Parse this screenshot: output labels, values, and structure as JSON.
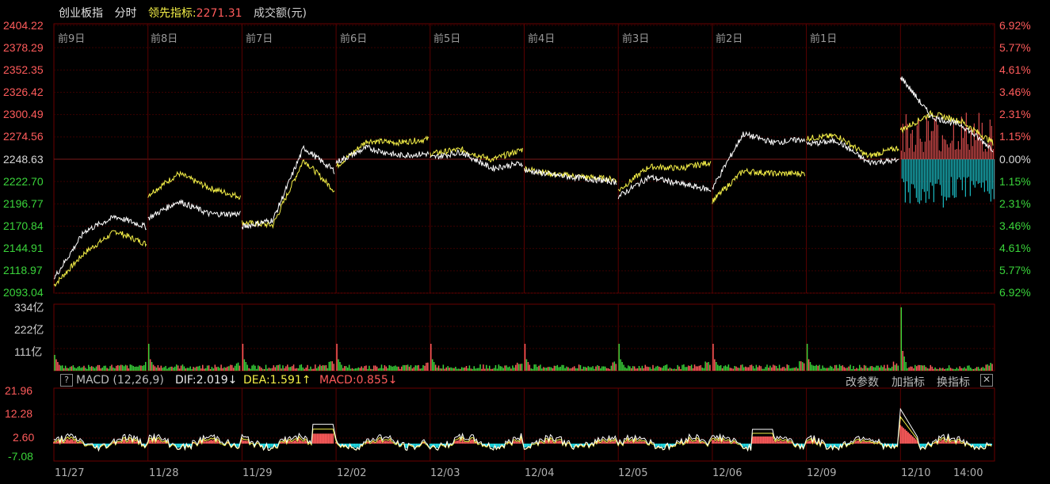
{
  "header": {
    "name": "创业板指",
    "mode": "分时",
    "lead_label": "领先指标:",
    "lead_value": "2271.31",
    "turnover_label": "成交额(元)"
  },
  "price_axis_left": [
    "2404.22",
    "2378.29",
    "2352.35",
    "2326.42",
    "2300.49",
    "2274.56",
    "2248.63",
    "2222.70",
    "2196.77",
    "2170.84",
    "2144.91",
    "2118.97",
    "2093.04"
  ],
  "pct_axis_right": [
    "6.92%",
    "5.77%",
    "4.61%",
    "3.46%",
    "2.31%",
    "1.15%",
    "0.00%",
    "1.15%",
    "2.31%",
    "3.46%",
    "4.61%",
    "5.77%",
    "6.92%"
  ],
  "day_labels": [
    "前9日",
    "前8日",
    "前7日",
    "前6日",
    "前5日",
    "前4日",
    "前3日",
    "前2日",
    "前1日"
  ],
  "volume_axis": [
    "334亿",
    "222亿",
    "111亿"
  ],
  "macd": {
    "question": "?",
    "title": "MACD (12,26,9)",
    "dif": "DIF:2.019↓",
    "dea": "DEA:1.591↑",
    "macd": "MACD:0.855↓",
    "axis": [
      "21.96",
      "12.28",
      "2.60",
      "-7.08"
    ]
  },
  "toolbar": {
    "change_params": "改参数",
    "add_indicator": "加指标",
    "switch_indicator": "换指标",
    "close": "✕"
  },
  "date_axis": [
    "11/27",
    "11/28",
    "11/29",
    "12/02",
    "12/03",
    "12/04",
    "12/05",
    "12/06",
    "12/09",
    "12/10",
    "14:00"
  ],
  "colors": {
    "up": "#ff5b5b",
    "down": "#3ad43a",
    "white_line": "#ffffff",
    "yellow_line": "#f5f047",
    "cyan": "#21e0e8",
    "grid": "#3a0000"
  },
  "chart_data": {
    "type": "line",
    "title": "创业板指",
    "xlabel": "",
    "ylabel": "",
    "ylim": [
      2093.04,
      2404.22
    ],
    "prev_close": 2248.63,
    "x": [
      "11/27",
      "11/28",
      "11/29",
      "12/02",
      "12/03",
      "12/04",
      "12/05",
      "12/06",
      "12/09",
      "12/10"
    ],
    "series": [
      {
        "name": "创业板指",
        "values": [
          [
            2110,
            2165,
            2182,
            2170
          ],
          [
            2180,
            2200,
            2185,
            2185
          ],
          [
            2170,
            2178,
            2262,
            2235
          ],
          [
            2245,
            2262,
            2253,
            2255
          ],
          [
            2250,
            2257,
            2238,
            2244
          ],
          [
            2236,
            2230,
            2226,
            2222
          ],
          [
            2205,
            2228,
            2220,
            2213
          ],
          [
            2215,
            2278,
            2268,
            2272
          ],
          [
            2266,
            2270,
            2245,
            2247
          ],
          [
            2345,
            2298,
            2288,
            2260
          ]
        ]
      },
      {
        "name": "领先指标",
        "values": [
          [
            2102,
            2140,
            2165,
            2150
          ],
          [
            2207,
            2232,
            2215,
            2205
          ],
          [
            2175,
            2172,
            2248,
            2212
          ],
          [
            2240,
            2270,
            2268,
            2272
          ],
          [
            2255,
            2260,
            2248,
            2260
          ],
          [
            2238,
            2231,
            2228,
            2225
          ],
          [
            2212,
            2240,
            2238,
            2245
          ],
          [
            2200,
            2235,
            2232,
            2232
          ],
          [
            2273,
            2276,
            2252,
            2262
          ],
          [
            2282,
            2302,
            2292,
            2268
          ]
        ]
      }
    ],
    "intraday_bars_last_day": {
      "up_max_pct": 2.5,
      "down_max_pct": 2.4
    }
  }
}
